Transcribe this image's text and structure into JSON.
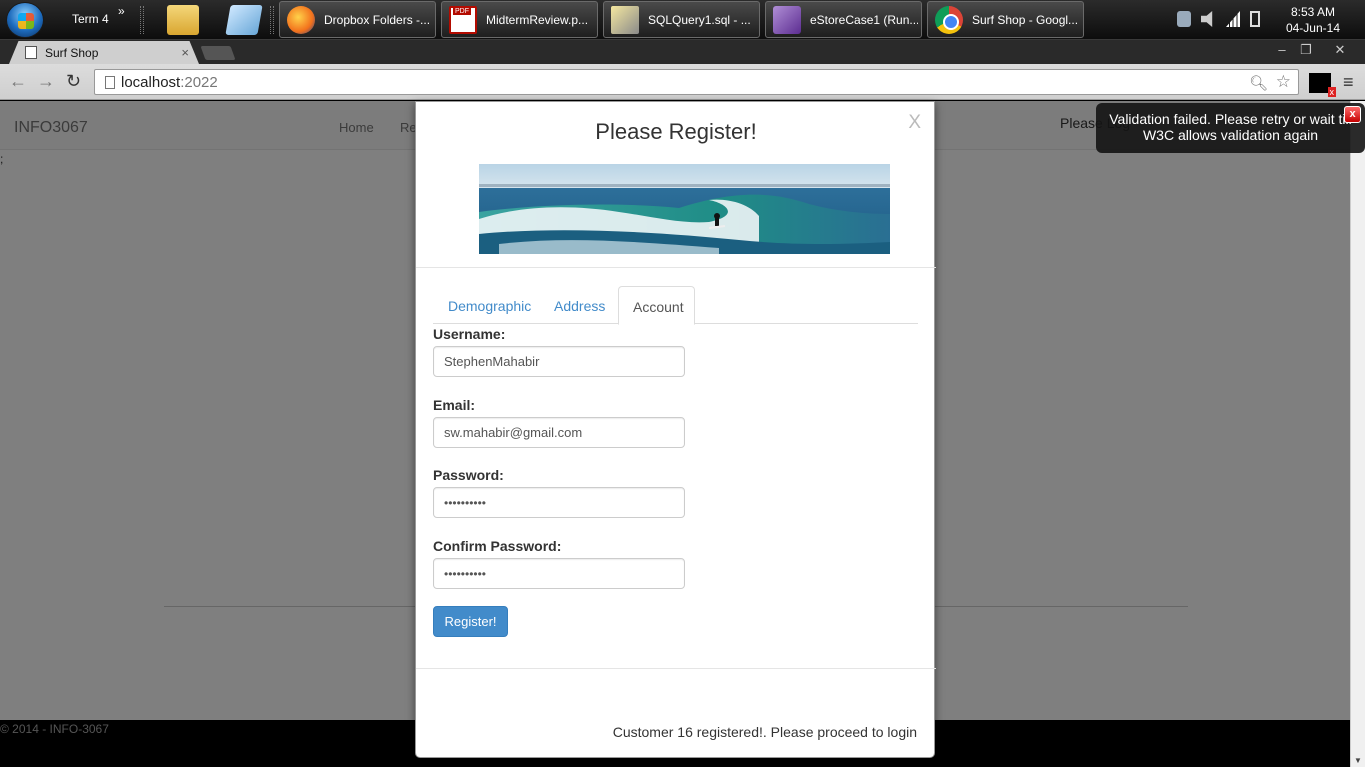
{
  "taskbar": {
    "term_label": "Term 4",
    "term_more": "»",
    "tasks": [
      {
        "label": "Dropbox Folders -...",
        "icon": "firefox-icon"
      },
      {
        "label": "MidtermReview.p...",
        "icon": "pdf-icon"
      },
      {
        "label": "SQLQuery1.sql - ...",
        "icon": "sql-icon"
      },
      {
        "label": "eStoreCase1 (Run...",
        "icon": "visual-studio-icon"
      },
      {
        "label": "Surf Shop - Googl...",
        "icon": "chrome-icon"
      }
    ],
    "clock_time": "8:53 AM",
    "clock_date": "04-Jun-14"
  },
  "browser": {
    "tab_title": "Surf Shop",
    "tab_close": "×",
    "url_host": "localhost",
    "url_port": ":2022",
    "win_minimize": "‒",
    "win_restore": "❐",
    "win_close": "✕"
  },
  "page": {
    "brand": "INFO3067",
    "nav_home": "Home",
    "nav_register": "Re",
    "nav_login": "Please Log",
    "stray_text": ";",
    "footer": "© 2014 - INFO-3067"
  },
  "modal": {
    "title": "Please Register!",
    "close": "X",
    "tabs": [
      "Demographic",
      "Address",
      "Account"
    ],
    "active_tab": "Account",
    "fields": {
      "username_label": "Username:",
      "username_value": "StephenMahabir",
      "email_label": "Email:",
      "email_value": "sw.mahabir@gmail.com",
      "password_label": "Password:",
      "password_value": "••••••••••",
      "confirm_label": "Confirm Password:",
      "confirm_value": "••••••••••"
    },
    "submit_label": "Register!",
    "status_message": "Customer 16 registered!. Please proceed to login"
  },
  "toast": {
    "message_line1": "Validation failed. Please retry or wait till",
    "message_line2": "W3C allows validation again",
    "close": "x"
  },
  "colors": {
    "accent": "#428bca",
    "overlay": "rgba(0,0,0,0.5)",
    "navbar_bg": "#f8f8f8"
  }
}
